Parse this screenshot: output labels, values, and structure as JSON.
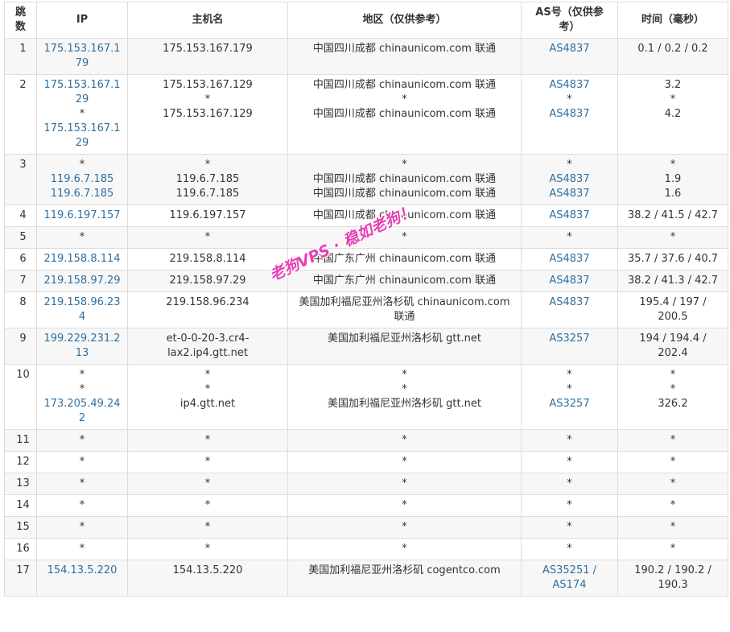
{
  "headers": {
    "hop": [
      "跳",
      "数"
    ],
    "ip": "IP",
    "hostname": "主机名",
    "region": "地区（仅供参考）",
    "as": [
      "AS号（仅供参",
      "考）"
    ],
    "time": "时间（毫秒）"
  },
  "rows": [
    {
      "hop": "1",
      "ip": [
        "175.153.167.179"
      ],
      "host": [
        "175.153.167.179"
      ],
      "region": [
        "中国四川成都 chinaunicom.com 联通"
      ],
      "as": [
        "AS4837"
      ],
      "time": [
        "0.1 / 0.2 / 0.2"
      ]
    },
    {
      "hop": "2",
      "ip": [
        "175.153.167.129",
        "*",
        "175.153.167.129"
      ],
      "host": [
        "175.153.167.129",
        "*",
        "175.153.167.129"
      ],
      "region": [
        "中国四川成都 chinaunicom.com 联通",
        "*",
        "中国四川成都 chinaunicom.com 联通"
      ],
      "as": [
        "AS4837",
        "*",
        "AS4837"
      ],
      "time": [
        "3.2",
        "*",
        "4.2"
      ]
    },
    {
      "hop": "3",
      "ip": [
        "*",
        "119.6.7.185",
        "119.6.7.185"
      ],
      "host": [
        "*",
        "119.6.7.185",
        "119.6.7.185"
      ],
      "region": [
        "*",
        "中国四川成都 chinaunicom.com 联通",
        "中国四川成都 chinaunicom.com 联通"
      ],
      "as": [
        "*",
        "AS4837",
        "AS4837"
      ],
      "time": [
        "*",
        "1.9",
        "1.6"
      ]
    },
    {
      "hop": "4",
      "ip": [
        "119.6.197.157"
      ],
      "host": [
        "119.6.197.157"
      ],
      "region": [
        "中国四川成都 chinaunicom.com 联通"
      ],
      "as": [
        "AS4837"
      ],
      "time": [
        "38.2 / 41.5 / 42.7"
      ]
    },
    {
      "hop": "5",
      "ip": [
        "*"
      ],
      "host": [
        "*"
      ],
      "region": [
        "*"
      ],
      "as": [
        "*"
      ],
      "time": [
        "*"
      ]
    },
    {
      "hop": "6",
      "ip": [
        "219.158.8.114"
      ],
      "host": [
        "219.158.8.114"
      ],
      "region": [
        "中国广东广州 chinaunicom.com 联通"
      ],
      "as": [
        "AS4837"
      ],
      "time": [
        "35.7 / 37.6 / 40.7"
      ]
    },
    {
      "hop": "7",
      "ip": [
        "219.158.97.29"
      ],
      "host": [
        "219.158.97.29"
      ],
      "region": [
        "中国广东广州 chinaunicom.com 联通"
      ],
      "as": [
        "AS4837"
      ],
      "time": [
        "38.2 / 41.3 / 42.7"
      ]
    },
    {
      "hop": "8",
      "ip": [
        "219.158.96.234"
      ],
      "host": [
        "219.158.96.234"
      ],
      "region": [
        "美国加利福尼亚州洛杉矶 chinaunicom.com 联通"
      ],
      "as": [
        "AS4837"
      ],
      "time": [
        "195.4 / 197 / 200.5"
      ]
    },
    {
      "hop": "9",
      "ip": [
        "199.229.231.213"
      ],
      "host": [
        "et-0-0-20-3.cr4-lax2.ip4.gtt.net"
      ],
      "region": [
        "美国加利福尼亚州洛杉矶 gtt.net"
      ],
      "as": [
        "AS3257"
      ],
      "time": [
        "194 / 194.4 / 202.4"
      ]
    },
    {
      "hop": "10",
      "ip": [
        "*",
        "*",
        "173.205.49.242"
      ],
      "host": [
        "*",
        "*",
        "ip4.gtt.net"
      ],
      "region": [
        "*",
        "*",
        "美国加利福尼亚州洛杉矶 gtt.net"
      ],
      "as": [
        "*",
        "*",
        "AS3257"
      ],
      "time": [
        "*",
        "*",
        "326.2"
      ]
    },
    {
      "hop": "11",
      "ip": [
        "*"
      ],
      "host": [
        "*"
      ],
      "region": [
        "*"
      ],
      "as": [
        "*"
      ],
      "time": [
        "*"
      ]
    },
    {
      "hop": "12",
      "ip": [
        "*"
      ],
      "host": [
        "*"
      ],
      "region": [
        "*"
      ],
      "as": [
        "*"
      ],
      "time": [
        "*"
      ]
    },
    {
      "hop": "13",
      "ip": [
        "*"
      ],
      "host": [
        "*"
      ],
      "region": [
        "*"
      ],
      "as": [
        "*"
      ],
      "time": [
        "*"
      ]
    },
    {
      "hop": "14",
      "ip": [
        "*"
      ],
      "host": [
        "*"
      ],
      "region": [
        "*"
      ],
      "as": [
        "*"
      ],
      "time": [
        "*"
      ]
    },
    {
      "hop": "15",
      "ip": [
        "*"
      ],
      "host": [
        "*"
      ],
      "region": [
        "*"
      ],
      "as": [
        "*"
      ],
      "time": [
        "*"
      ]
    },
    {
      "hop": "16",
      "ip": [
        "*"
      ],
      "host": [
        "*"
      ],
      "region": [
        "*"
      ],
      "as": [
        "*"
      ],
      "time": [
        "*"
      ]
    },
    {
      "hop": "17",
      "ip": [
        "154.13.5.220"
      ],
      "host": [
        "154.13.5.220"
      ],
      "region": [
        "美国加利福尼亚州洛杉矶 cogentco.com"
      ],
      "as": [
        "AS35251 / AS174"
      ],
      "time": [
        "190.2 / 190.2 / 190.3"
      ]
    }
  ],
  "watermark": "老狗VPS · 稳如老狗！",
  "colors": {
    "link": "#2f6f9f",
    "watermark": "#e83fb4",
    "row_alt": "#f7f7f7",
    "border": "#dddddd"
  }
}
